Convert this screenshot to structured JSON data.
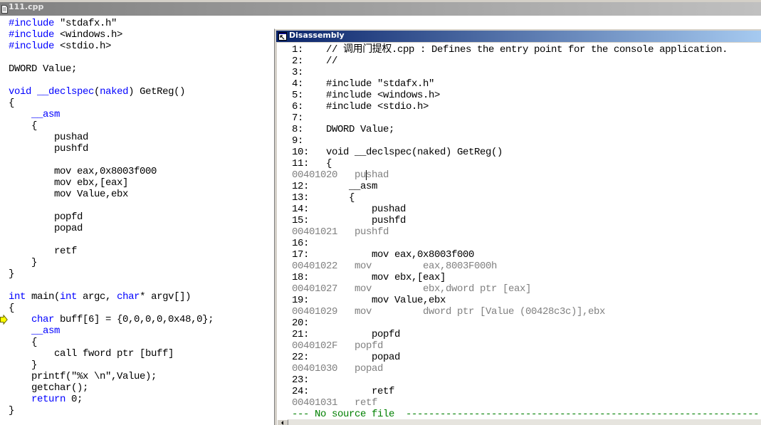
{
  "editor": {
    "title": "111.cpp",
    "title_icon": "document-icon",
    "current_line_marker_icon": "current-line-arrow-icon",
    "lines": [
      [
        {
          "t": "#include",
          "kw": true
        },
        {
          "t": " \"stdafx.h\""
        }
      ],
      [
        {
          "t": "#include",
          "kw": true
        },
        {
          "t": " <windows.h>"
        }
      ],
      [
        {
          "t": "#include",
          "kw": true
        },
        {
          "t": " <stdio.h>"
        }
      ],
      [],
      [
        {
          "t": "DWORD Value;"
        }
      ],
      [],
      [
        {
          "t": "void",
          "kw": true
        },
        {
          "t": " "
        },
        {
          "t": "__declspec",
          "kw": true
        },
        {
          "t": "("
        },
        {
          "t": "naked",
          "kw": true
        },
        {
          "t": ") GetReg()"
        }
      ],
      [
        {
          "t": "{"
        }
      ],
      [
        {
          "t": "    "
        },
        {
          "t": "__asm",
          "kw": true
        }
      ],
      [
        {
          "t": "    {"
        }
      ],
      [
        {
          "t": "        pushad"
        }
      ],
      [
        {
          "t": "        pushfd"
        }
      ],
      [],
      [
        {
          "t": "        mov eax,0x8003f000"
        }
      ],
      [
        {
          "t": "        mov ebx,[eax]"
        }
      ],
      [
        {
          "t": "        mov Value,ebx"
        }
      ],
      [],
      [
        {
          "t": "        popfd"
        }
      ],
      [
        {
          "t": "        popad"
        }
      ],
      [],
      [
        {
          "t": "        retf"
        }
      ],
      [
        {
          "t": "    }"
        }
      ],
      [
        {
          "t": "}"
        }
      ],
      [],
      [
        {
          "t": "int",
          "kw": true
        },
        {
          "t": " main("
        },
        {
          "t": "int",
          "kw": true
        },
        {
          "t": " argc, "
        },
        {
          "t": "char",
          "kw": true
        },
        {
          "t": "* argv[])"
        }
      ],
      [
        {
          "t": "{"
        }
      ],
      [
        {
          "t": "    "
        },
        {
          "t": "char",
          "kw": true
        },
        {
          "t": " buff[6] = {0,0,0,0,0x48,0};"
        }
      ],
      [
        {
          "t": "    "
        },
        {
          "t": "__asm",
          "kw": true
        }
      ],
      [
        {
          "t": "    {"
        }
      ],
      [
        {
          "t": "        call fword ptr [buff]"
        }
      ],
      [
        {
          "t": "    }"
        }
      ],
      [
        {
          "t": "    printf(\"%x \\n\",Value);"
        }
      ],
      [
        {
          "t": "    getchar();"
        }
      ],
      [
        {
          "t": "    "
        },
        {
          "t": "return",
          "kw": true
        },
        {
          "t": " 0;"
        }
      ],
      [
        {
          "t": "}"
        }
      ]
    ]
  },
  "disassembly": {
    "title": "Disassembly",
    "title_icon": "disassembly-window-icon",
    "lines": [
      {
        "num": "1:",
        "code": "// 调用门提权.cpp : Defines the entry point for the console application."
      },
      {
        "num": "2:",
        "code": "//"
      },
      {
        "num": "3:"
      },
      {
        "num": "4:",
        "code": "#include \"stdafx.h\""
      },
      {
        "num": "5:",
        "code": "#include <windows.h>"
      },
      {
        "num": "6:",
        "code": "#include <stdio.h>"
      },
      {
        "num": "7:"
      },
      {
        "num": "8:",
        "code": "DWORD Value;"
      },
      {
        "num": "9:"
      },
      {
        "num": "10:",
        "code": "void __declspec(naked) GetReg()"
      },
      {
        "num": "11:",
        "code": "{"
      },
      {
        "addr": "00401020",
        "op": "pushad"
      },
      {
        "num": "12:",
        "code": "    __asm"
      },
      {
        "num": "13:",
        "code": "    {"
      },
      {
        "num": "14:",
        "code": "        pushad"
      },
      {
        "num": "15:",
        "code": "        pushfd"
      },
      {
        "addr": "00401021",
        "op": "pushfd"
      },
      {
        "num": "16:"
      },
      {
        "num": "17:",
        "code": "        mov eax,0x8003f000"
      },
      {
        "addr": "00401022",
        "op": "mov",
        "args": "eax,8003F000h"
      },
      {
        "num": "18:",
        "code": "        mov ebx,[eax]"
      },
      {
        "addr": "00401027",
        "op": "mov",
        "args": "ebx,dword ptr [eax]"
      },
      {
        "num": "19:",
        "code": "        mov Value,ebx"
      },
      {
        "addr": "00401029",
        "op": "mov",
        "args": "dword ptr [Value (00428c3c)],ebx"
      },
      {
        "num": "20:"
      },
      {
        "num": "21:",
        "code": "        popfd"
      },
      {
        "addr": "0040102F",
        "op": "popfd"
      },
      {
        "num": "22:",
        "code": "        popad"
      },
      {
        "addr": "00401030",
        "op": "popad"
      },
      {
        "num": "23:"
      },
      {
        "num": "24:",
        "code": "        retf"
      },
      {
        "addr": "00401031",
        "op": "retf"
      },
      {
        "note": "--- No source file  --------------------------------------------------------------"
      }
    ]
  },
  "theme": {
    "keyword": "#0000ff",
    "text": "#000000",
    "disassembly_code": "#808080",
    "no_source": "#008000",
    "active_title_start": "#0a246a",
    "active_title_end": "#a6caf0",
    "inactive_title_start": "#808080",
    "inactive_title_end": "#c0c0c0",
    "execution_marker": "#ffff00"
  }
}
